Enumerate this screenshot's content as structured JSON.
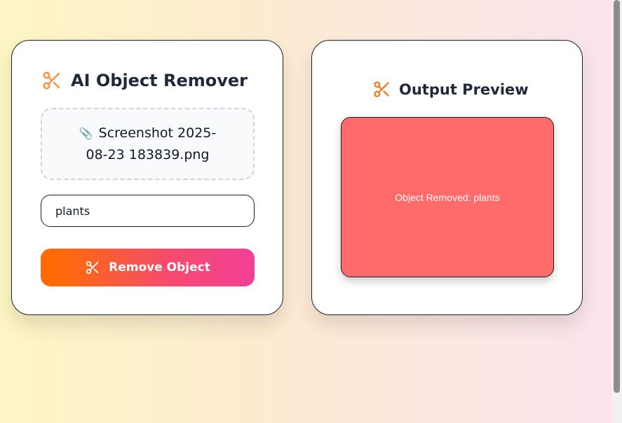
{
  "remover_panel": {
    "title": "AI Object Remover",
    "title_icon": "scissors-icon",
    "file": {
      "icon": "paperclip-icon",
      "icon_glyph": "📎",
      "name": "Screenshot 2025-08-23 183839.png"
    },
    "object_input": {
      "value": "plants",
      "placeholder": ""
    },
    "remove_button": {
      "icon": "scissors-icon",
      "label": "Remove Object"
    }
  },
  "preview_panel": {
    "title": "Output Preview",
    "title_icon": "scissors-icon",
    "result_text": "Object Removed: plants"
  },
  "colors": {
    "accent_orange": "#f97316",
    "gradient_start": "#ff6a00",
    "gradient_end": "#f43f96",
    "preview_fill": "#ff6b6b"
  }
}
